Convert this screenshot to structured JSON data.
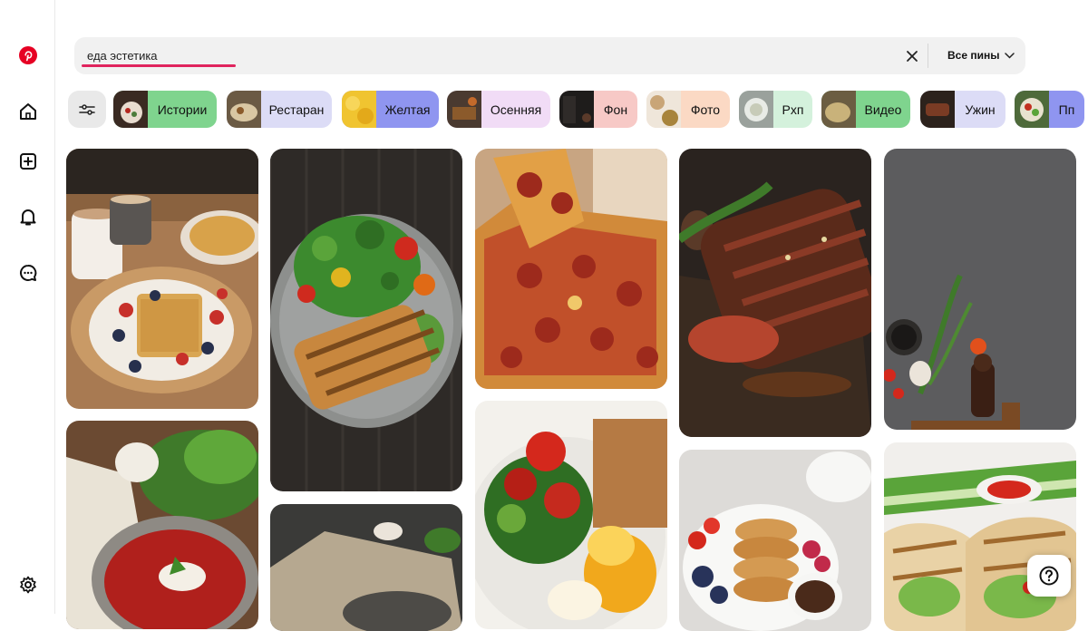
{
  "search": {
    "query": "еда эстетика",
    "filter_label": "Все пины"
  },
  "sidebar": {
    "items": [
      "pinterest-logo",
      "home-icon",
      "create-icon",
      "notifications-icon",
      "messages-icon",
      "settings-icon"
    ]
  },
  "chips": [
    {
      "label": "Истории",
      "bg": "#7fd48e"
    },
    {
      "label": "Рестаран",
      "bg": "#dcdcf6"
    },
    {
      "label": "Желтая",
      "bg": "#8f95f0"
    },
    {
      "label": "Осенняя",
      "bg": "#f1dcf6"
    },
    {
      "label": "Фон",
      "bg": "#f7c9c6"
    },
    {
      "label": "Фото",
      "bg": "#fbd9c4"
    },
    {
      "label": "Рхп",
      "bg": "#d4f1dc"
    },
    {
      "label": "Видео",
      "bg": "#7fd48e"
    },
    {
      "label": "Ужин",
      "bg": "#dcdcf6"
    },
    {
      "label": "Пп",
      "bg": "#8f95f0"
    }
  ],
  "colors": {
    "accent": "#e60023",
    "underline": "#e0245e"
  },
  "help": {
    "icon": "question-icon"
  }
}
